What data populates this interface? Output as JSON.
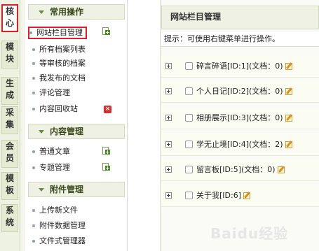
{
  "tabs": [
    {
      "label": "核心",
      "active": true
    },
    {
      "label": "模块",
      "active": false
    },
    {
      "label": "生成",
      "active": false
    },
    {
      "label": "采集",
      "active": false
    },
    {
      "label": "会员",
      "active": false
    },
    {
      "label": "模板",
      "active": false
    },
    {
      "label": "系统",
      "active": false
    }
  ],
  "menu": {
    "sections": [
      {
        "title": "常用操作",
        "items": [
          {
            "label": "网站栏目管理",
            "icon": "add-icon",
            "highlighted": true
          },
          {
            "label": "所有档案列表"
          },
          {
            "label": "等审核的档案"
          },
          {
            "label": "我发布的文档"
          },
          {
            "label": "评论管理"
          },
          {
            "label": "内容回收站",
            "icon": "delete-icon"
          }
        ]
      },
      {
        "title": "内容管理",
        "items": [
          {
            "label": "普通文章",
            "icon": "add-icon"
          },
          {
            "label": "专题管理",
            "icon": "add-icon"
          }
        ]
      },
      {
        "title": "附件管理",
        "items": [
          {
            "label": "上传新文件"
          },
          {
            "label": "附件数据管理"
          },
          {
            "label": "文件式管理器"
          }
        ]
      }
    ]
  },
  "main": {
    "title": "网站栏目管理",
    "hint": "提示：可使用右键菜单进行操作。",
    "rows": [
      {
        "text": "碎言碎语[ID:1](文档：0)"
      },
      {
        "text": "个人日记[ID:2](文档：0)"
      },
      {
        "text": "相册展示[ID:3](文档：0)"
      },
      {
        "text": "学无止境[ID:4](文档：2)"
      },
      {
        "text": "留言板[ID:5](文档：0)"
      },
      {
        "text": "关于我[ID:6]"
      }
    ]
  },
  "watermark": "Baidu经验",
  "colors": {
    "accent_red": "#e02020",
    "header_bg": "#eef1e4",
    "row_bg": "#fcfdf2"
  }
}
